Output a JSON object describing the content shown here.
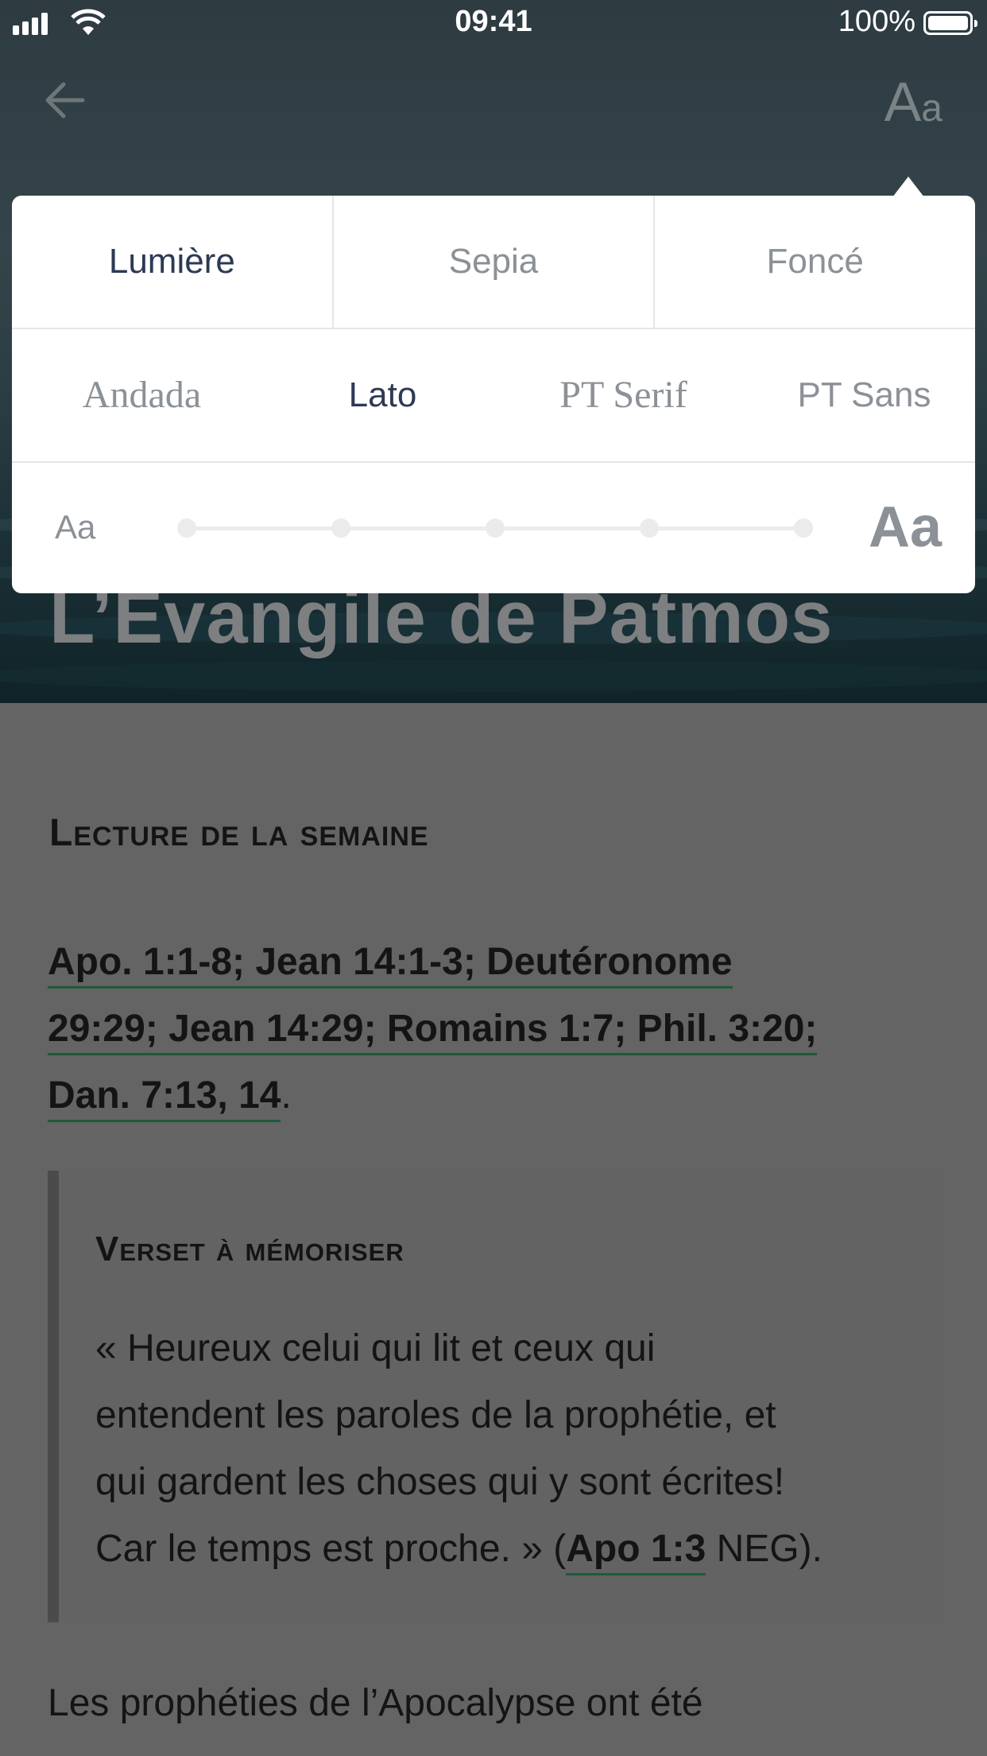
{
  "status_bar": {
    "time": "09:41",
    "battery": "100%"
  },
  "header": {
    "back_icon": "arrow-left-icon",
    "font_button": {
      "big": "A",
      "small": "a"
    },
    "title": "L’Evangile de Patmos"
  },
  "settings": {
    "themes": [
      {
        "label": "Lumière",
        "selected": true
      },
      {
        "label": "Sepia",
        "selected": false
      },
      {
        "label": "Foncé",
        "selected": false
      }
    ],
    "fonts": [
      {
        "label": "Andada",
        "selected": false
      },
      {
        "label": "Lato",
        "selected": true
      },
      {
        "label": "PT Serif",
        "selected": false
      },
      {
        "label": "PT Sans",
        "selected": false
      }
    ],
    "size_small_label": "Aa",
    "size_large_label": "Aa",
    "size_steps": 5,
    "size_selected_step": 1
  },
  "content": {
    "section_title": "Lecture de la semaine",
    "refs": [
      "Apo. 1:1-8; Jean 14:1-3; Deutéronome",
      "29:29; Jean 14:29; Romains 1:7; Phil. 3:20;",
      "Dan. 7:13, 14"
    ],
    "refs_end": ".",
    "verse_title": "Verset à mémoriser",
    "verse_lines": [
      "« Heureux celui qui lit et ceux qui",
      "entendent les paroles de la prophétie, et",
      "qui gardent les choses qui y sont écrites!"
    ],
    "verse_last_start": "Car le temps est proche. » (",
    "verse_ref": "Apo 1:3",
    "verse_last_end": " NEG).",
    "paragraph_start": "Les prophéties de l’Apocalypse ont été"
  },
  "colors": {
    "accent": "#2d3a55",
    "link_underline": "#1d5a3a",
    "overlay": "#646464"
  }
}
